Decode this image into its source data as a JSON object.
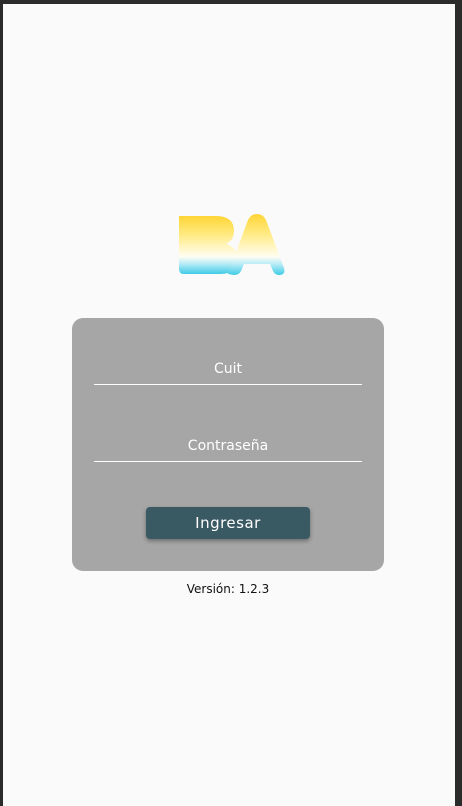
{
  "logo": {
    "icon": "ba-logo-icon",
    "text": "BA",
    "colors": {
      "top": "#ffd840",
      "middle": "#fffbe6",
      "bottom": "#4fcfe6"
    }
  },
  "login": {
    "cuit_placeholder": "Cuit",
    "password_placeholder": "Contraseña",
    "submit_label": "Ingresar",
    "colors": {
      "card": "#a6a6a6",
      "button": "#3a5a63"
    }
  },
  "version_text": "Versión: 1.2.3"
}
